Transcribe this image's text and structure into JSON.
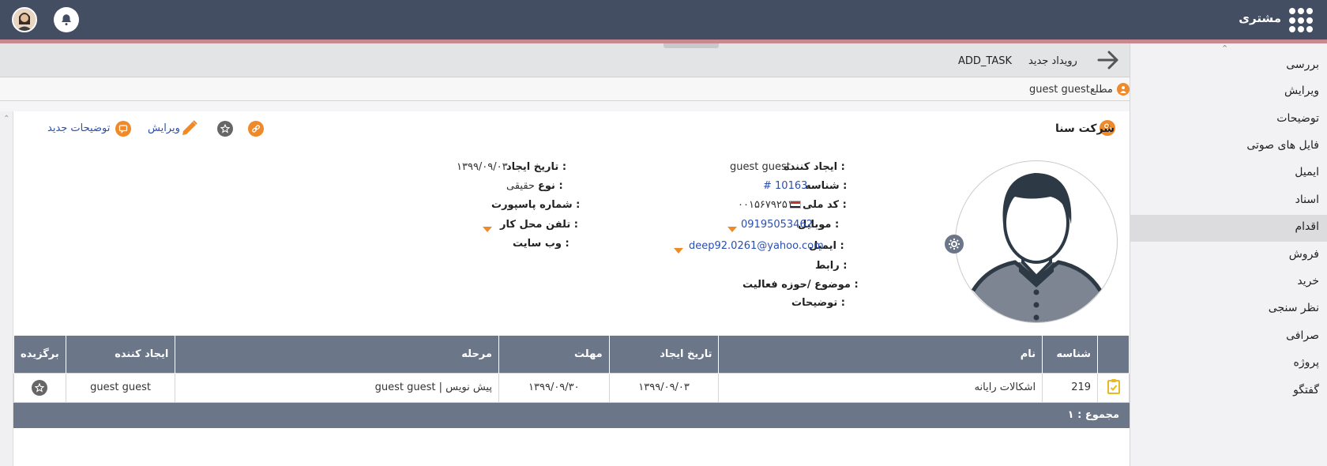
{
  "header": {
    "app_title": "مشتری"
  },
  "sidebar": {
    "items": [
      {
        "label": "بررسی"
      },
      {
        "label": "ویرایش"
      },
      {
        "label": "توضیحات"
      },
      {
        "label": "فایل های صوتی"
      },
      {
        "label": "ایمیل"
      },
      {
        "label": "اسناد"
      },
      {
        "label": "اقدام"
      },
      {
        "label": "فروش"
      },
      {
        "label": "خرید"
      },
      {
        "label": "نظر سنجی"
      },
      {
        "label": "صرافی"
      },
      {
        "label": "پروژه"
      },
      {
        "label": "گفتگو"
      }
    ],
    "active_index": 6
  },
  "toolbar": {
    "new_event": "رویداد جدید",
    "add_task": "ADD_TASK"
  },
  "followers": {
    "label": "مطلع",
    "user": "guest guest"
  },
  "panel": {
    "company_name": "شرکت سنا",
    "edit_label": "ویرایش",
    "new_notes_label": "توضیحات جدید"
  },
  "details_right": {
    "creator_label": "ایجاد کننده :",
    "creator_value": "guest guest",
    "id_label": "شناسه :",
    "id_value": "# 10163",
    "national_code_label": "کد ملی :",
    "national_code_value": "۰۰۱۵۶۷۹۲۵۱",
    "mobile_label": "موبایل :",
    "mobile_value": "09195053462",
    "email_label": "ایمیل :",
    "email_value": "deep92.0261@yahoo.com",
    "liaison_label": "رابط :",
    "subject_label": "موضوع /حوزه فعالیت :",
    "notes_label": "توضیحات :"
  },
  "details_left": {
    "created_date_label": "تاریخ ایجاد :",
    "created_date_value": "۱۳۹۹/۰۹/۰۳",
    "type_label": "نوع :",
    "type_value": "حقیقی",
    "passport_label": "شماره پاسپورت :",
    "work_phone_label": "تلفن محل کار :",
    "website_label": "وب سایت :"
  },
  "table": {
    "columns": [
      "شناسه",
      "نام",
      "تاریخ ایجاد",
      "مهلت",
      "مرحله",
      "ایجاد کننده",
      "برگزیده"
    ],
    "rows": [
      {
        "id": "219",
        "name": "اشکالات رایانه",
        "created": "۱۳۹۹/۰۹/۰۳",
        "deadline": "۱۳۹۹/۰۹/۳۰",
        "stage": "پیش نویس | guest guest",
        "creator": "guest guest"
      }
    ],
    "total_label": "مجموع : ۱"
  },
  "colors": {
    "header_bg": "#434e63",
    "accent": "#ef8a2b",
    "table_header": "#6b7688"
  }
}
